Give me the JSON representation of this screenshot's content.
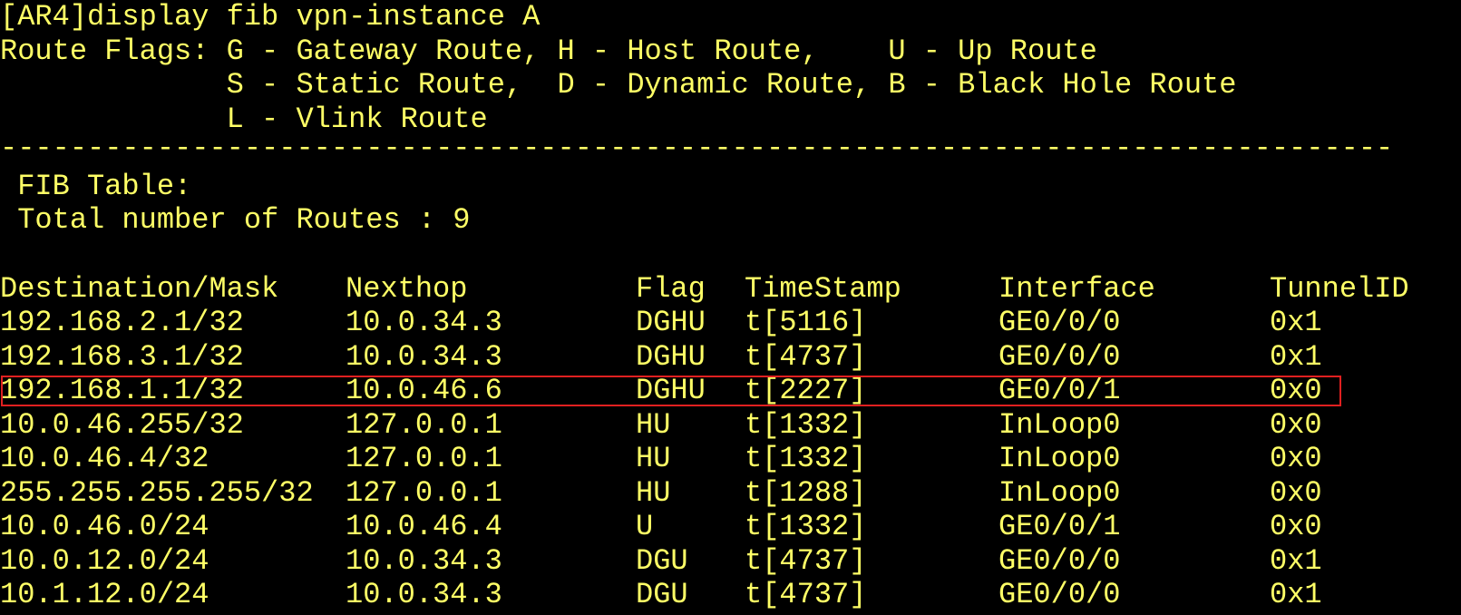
{
  "command_line": "[AR4]display fib vpn-instance A",
  "route_flags": {
    "line1": "Route Flags: G - Gateway Route, H - Host Route,    U - Up Route",
    "line2": "             S - Static Route,  D - Dynamic Route, B - Black Hole Route",
    "line3": "             L - Vlink Route"
  },
  "separator": "--------------------------------------------------------------------------------",
  "fib_table_label": " FIB Table:",
  "total_routes_label": " Total number of Routes : 9",
  "table": {
    "headers": {
      "destination": "Destination/Mask",
      "nexthop": "Nexthop",
      "flag": "Flag",
      "timestamp": "TimeStamp",
      "interface": "Interface",
      "tunnel_id": "TunnelID"
    },
    "rows": [
      {
        "destination": "192.168.2.1/32",
        "nexthop": "10.0.34.3",
        "flag": "DGHU",
        "timestamp": "t[5116]",
        "interface": "GE0/0/0",
        "tunnel_id": "0x1"
      },
      {
        "destination": "192.168.3.1/32",
        "nexthop": "10.0.34.3",
        "flag": "DGHU",
        "timestamp": "t[4737]",
        "interface": "GE0/0/0",
        "tunnel_id": "0x1"
      },
      {
        "destination": "192.168.1.1/32",
        "nexthop": "10.0.46.6",
        "flag": "DGHU",
        "timestamp": "t[2227]",
        "interface": "GE0/0/1",
        "tunnel_id": "0x0"
      },
      {
        "destination": "10.0.46.255/32",
        "nexthop": "127.0.0.1",
        "flag": "HU",
        "timestamp": "t[1332]",
        "interface": "InLoop0",
        "tunnel_id": "0x0"
      },
      {
        "destination": "10.0.46.4/32",
        "nexthop": "127.0.0.1",
        "flag": "HU",
        "timestamp": "t[1332]",
        "interface": "InLoop0",
        "tunnel_id": "0x0"
      },
      {
        "destination": "255.255.255.255/32",
        "nexthop": "127.0.0.1",
        "flag": "HU",
        "timestamp": "t[1288]",
        "interface": "InLoop0",
        "tunnel_id": "0x0"
      },
      {
        "destination": "10.0.46.0/24",
        "nexthop": "10.0.46.4",
        "flag": "U",
        "timestamp": "t[1332]",
        "interface": "GE0/0/1",
        "tunnel_id": "0x0"
      },
      {
        "destination": "10.0.12.0/24",
        "nexthop": "10.0.34.3",
        "flag": "DGU",
        "timestamp": "t[4737]",
        "interface": "GE0/0/0",
        "tunnel_id": "0x1"
      },
      {
        "destination": "10.1.12.0/24",
        "nexthop": "10.0.34.3",
        "flag": "DGU",
        "timestamp": "t[4737]",
        "interface": "GE0/0/0",
        "tunnel_id": "0x1"
      }
    ]
  },
  "colors": {
    "background": "#000000",
    "text": "#FFFF66",
    "highlight_border": "#E02020"
  }
}
